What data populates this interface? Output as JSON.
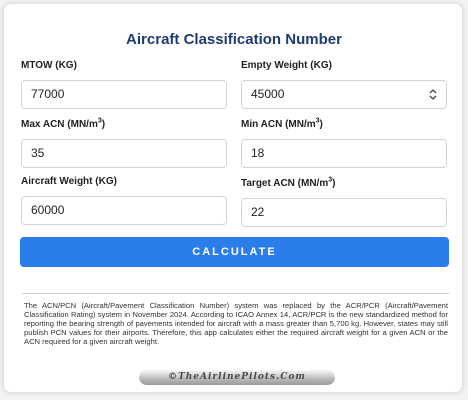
{
  "title": "Aircraft Classification Number",
  "fields": {
    "mtow": {
      "label": "MTOW (KG)",
      "value": "77000"
    },
    "empty_weight": {
      "label": "Empty Weight (KG)",
      "value": "45000"
    },
    "max_acn": {
      "label": "Max ACN (MN/m",
      "label_sup": "3",
      "label_end": ")",
      "value": "35"
    },
    "min_acn": {
      "label": "Min ACN (MN/m",
      "label_sup": "3",
      "label_end": ")",
      "value": "18"
    },
    "aircraft_weight": {
      "label": "Aircraft Weight (KG)",
      "value": "60000"
    },
    "target_acn": {
      "label": "Target ACN (MN/m",
      "label_sup": "3",
      "label_end": ")",
      "value": "22"
    }
  },
  "calculate_label": "CALCULATE",
  "info_text": "The ACN/PCN (Aircraft/Pavement Classification Number) system was replaced by the ACR/PCR (Aircraft/Pavement Classification Rating) system in November 2024. According to ICAO Annex 14, ACR/PCR is the new standardized method for reporting the bearing strength of pavements intended for aircraft with a mass greater than 5,700 kg. However, states may still publish PCN values for their airports. Therefore, this app calculates either the required aircraft weight for a given ACN or the ACN required for a given aircraft weight.",
  "watermark": "©TheAirlinePilots.Com",
  "colors": {
    "title": "#1f3b73",
    "button": "#2b7de9"
  },
  "icons": {
    "select_arrows": "updown-arrows-icon"
  }
}
